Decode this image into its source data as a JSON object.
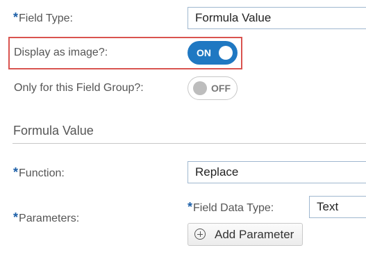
{
  "fields": {
    "field_type": {
      "required_mark": "*",
      "label": "Field Type:",
      "value": "Formula Value"
    },
    "display_as_image": {
      "label": "Display as image?:",
      "toggle_text": "ON",
      "state": "on"
    },
    "only_field_group": {
      "label": "Only for this Field Group?:",
      "toggle_text": "OFF",
      "state": "off"
    }
  },
  "section": {
    "title": "Formula Value"
  },
  "formula": {
    "function": {
      "required_mark": "*",
      "label": "Function:",
      "value": "Replace"
    },
    "parameters": {
      "required_mark": "*",
      "label": "Parameters:"
    },
    "field_data_type": {
      "required_mark": "*",
      "label": "Field Data Type:",
      "value": "Text"
    },
    "add_parameter_label": "Add Parameter"
  },
  "colors": {
    "accent": "#1f78c2",
    "required": "#1c5fa8",
    "highlight_border": "#d9534f"
  }
}
